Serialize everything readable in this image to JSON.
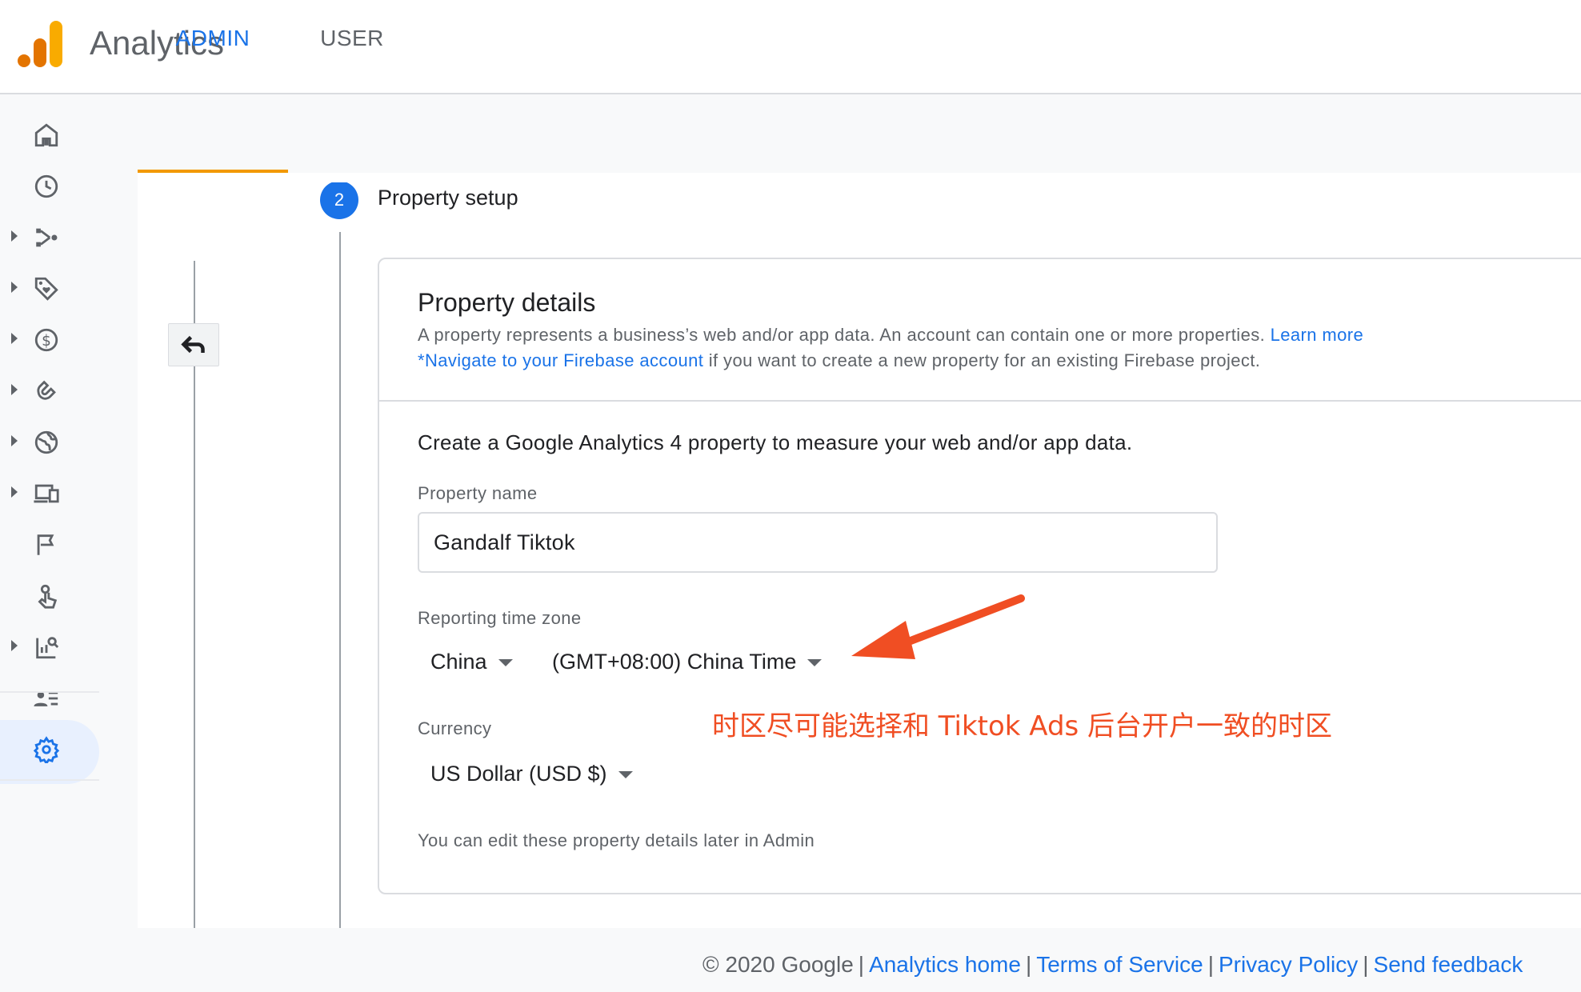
{
  "header": {
    "app_title": "Analytics"
  },
  "tabs": [
    {
      "label": "ADMIN",
      "active": true
    },
    {
      "label": "USER",
      "active": false
    }
  ],
  "left_nav": [
    {
      "icon": "home-icon"
    },
    {
      "icon": "clock-icon"
    },
    {
      "icon": "flow-icon"
    },
    {
      "icon": "tag-heart-icon"
    },
    {
      "icon": "dollar-icon"
    },
    {
      "icon": "magnet-icon"
    },
    {
      "icon": "globe-icon"
    },
    {
      "icon": "devices-icon"
    },
    {
      "icon": "flag-icon"
    },
    {
      "icon": "touch-icon"
    },
    {
      "icon": "report-search-icon"
    },
    {
      "icon": "audience-icon"
    },
    {
      "icon": "gear-icon"
    }
  ],
  "step": {
    "number": "2",
    "title": "Property setup"
  },
  "card": {
    "title": "Property details",
    "desc_text": "A property represents a business’s web and/or app data. An account can contain one or more properties. ",
    "desc_link": "Learn more",
    "desc2_link": "*Navigate to your Firebase account",
    "desc2_text": " if you want to create a new property for an existing Firebase project.",
    "intro": "Create a Google Analytics 4 property to measure your web and/or app data.",
    "property_name_label": "Property name",
    "property_name_value": "Gandalf Tiktok",
    "timezone_label": "Reporting time zone",
    "country_value": "China",
    "timezone_value": "(GMT+08:00) China Time",
    "currency_label": "Currency",
    "currency_value": "US Dollar (USD $)",
    "footnote": "You can edit these property details later in Admin"
  },
  "annotation": {
    "text": "时区尽可能选择和 Tiktok Ads 后台开户一致的时区",
    "color": "#f04e23"
  },
  "footer": {
    "copyright": "© 2020 Google",
    "links": [
      "Analytics home",
      "Terms of Service",
      "Privacy Policy",
      "Send feedback"
    ]
  },
  "colors": {
    "accent": "#1a73e8",
    "tab_underline": "#f29900",
    "annotation": "#f04e23"
  }
}
